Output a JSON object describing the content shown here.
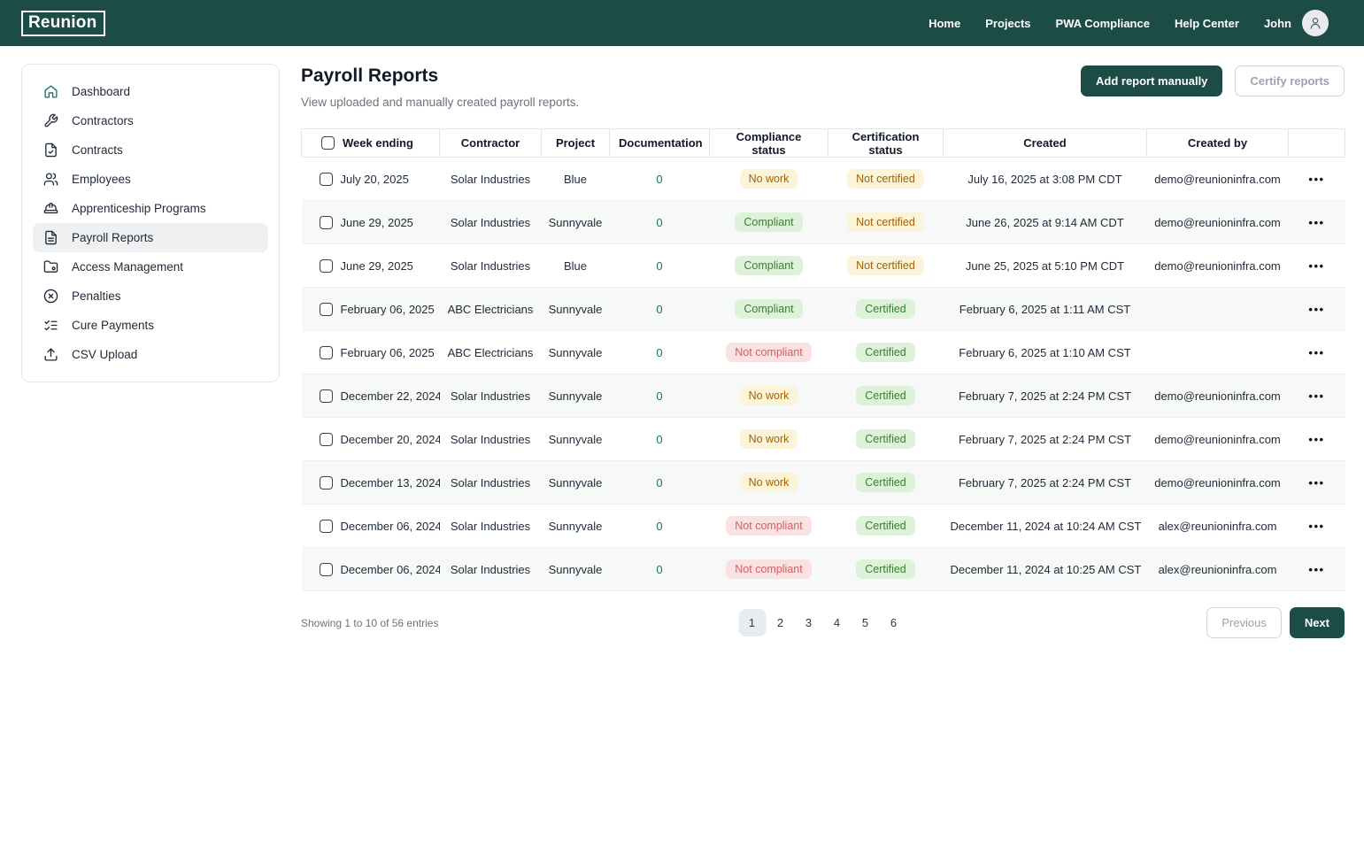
{
  "brand": {
    "logo": "Reunion"
  },
  "navbar": {
    "items": [
      {
        "label": "Home"
      },
      {
        "label": "Projects"
      },
      {
        "label": "PWA Compliance"
      },
      {
        "label": "Help Center"
      }
    ],
    "user": "John"
  },
  "sidebar": {
    "items": [
      {
        "label": "Dashboard",
        "icon": "home-icon",
        "active": false,
        "accent": true
      },
      {
        "label": "Contractors",
        "icon": "wrench-icon",
        "active": false
      },
      {
        "label": "Contracts",
        "icon": "file-check-icon",
        "active": false
      },
      {
        "label": "Employees",
        "icon": "users-icon",
        "active": false
      },
      {
        "label": "Apprenticeship Programs",
        "icon": "hard-hat-icon",
        "active": false
      },
      {
        "label": "Payroll Reports",
        "icon": "file-text-icon",
        "active": true
      },
      {
        "label": "Access Management",
        "icon": "folder-user-icon",
        "active": false
      },
      {
        "label": "Penalties",
        "icon": "x-circle-icon",
        "active": false
      },
      {
        "label": "Cure Payments",
        "icon": "list-checks-icon",
        "active": false
      },
      {
        "label": "CSV Upload",
        "icon": "upload-icon",
        "active": false
      }
    ]
  },
  "page": {
    "title": "Payroll Reports",
    "subtitle": "View uploaded and manually created payroll reports.",
    "add_button": "Add report manually",
    "certify_button": "Certify reports"
  },
  "table": {
    "columns": [
      "Week ending",
      "Contractor",
      "Project",
      "Documentation",
      "Compliance status",
      "Certification status",
      "Created",
      "Created by"
    ],
    "rows": [
      {
        "week": "July 20, 2025",
        "contractor": "Solar Industries",
        "project": "Blue",
        "documentation": "0",
        "compliance": {
          "label": "No work",
          "type": "warning"
        },
        "certification": {
          "label": "Not certified",
          "type": "warning"
        },
        "created": "July 16, 2025 at 3:08 PM CDT",
        "created_by": "demo@reunioninfra.com"
      },
      {
        "week": "June 29, 2025",
        "contractor": "Solar Industries",
        "project": "Sunnyvale",
        "documentation": "0",
        "compliance": {
          "label": "Compliant",
          "type": "success"
        },
        "certification": {
          "label": "Not certified",
          "type": "warning"
        },
        "created": "June 26, 2025 at 9:14 AM CDT",
        "created_by": "demo@reunioninfra.com"
      },
      {
        "week": "June 29, 2025",
        "contractor": "Solar Industries",
        "project": "Blue",
        "documentation": "0",
        "compliance": {
          "label": "Compliant",
          "type": "success"
        },
        "certification": {
          "label": "Not certified",
          "type": "warning"
        },
        "created": "June 25, 2025 at 5:10 PM CDT",
        "created_by": "demo@reunioninfra.com"
      },
      {
        "week": "February 06, 2025",
        "contractor": "ABC Electricians",
        "project": "Sunnyvale",
        "documentation": "0",
        "compliance": {
          "label": "Compliant",
          "type": "success"
        },
        "certification": {
          "label": "Certified",
          "type": "success"
        },
        "created": "February 6, 2025 at 1:11 AM CST",
        "created_by": ""
      },
      {
        "week": "February 06, 2025",
        "contractor": "ABC Electricians",
        "project": "Sunnyvale",
        "documentation": "0",
        "compliance": {
          "label": "Not compliant",
          "type": "danger"
        },
        "certification": {
          "label": "Certified",
          "type": "success"
        },
        "created": "February 6, 2025 at 1:10 AM CST",
        "created_by": ""
      },
      {
        "week": "December 22, 2024",
        "contractor": "Solar Industries",
        "project": "Sunnyvale",
        "documentation": "0",
        "compliance": {
          "label": "No work",
          "type": "warning"
        },
        "certification": {
          "label": "Certified",
          "type": "success"
        },
        "created": "February 7, 2025 at 2:24 PM CST",
        "created_by": "demo@reunioninfra.com"
      },
      {
        "week": "December 20, 2024",
        "contractor": "Solar Industries",
        "project": "Sunnyvale",
        "documentation": "0",
        "compliance": {
          "label": "No work",
          "type": "warning"
        },
        "certification": {
          "label": "Certified",
          "type": "success"
        },
        "created": "February 7, 2025 at 2:24 PM CST",
        "created_by": "demo@reunioninfra.com"
      },
      {
        "week": "December 13, 2024",
        "contractor": "Solar Industries",
        "project": "Sunnyvale",
        "documentation": "0",
        "compliance": {
          "label": "No work",
          "type": "warning"
        },
        "certification": {
          "label": "Certified",
          "type": "success"
        },
        "created": "February 7, 2025 at 2:24 PM CST",
        "created_by": "demo@reunioninfra.com"
      },
      {
        "week": "December 06, 2024",
        "contractor": "Solar Industries",
        "project": "Sunnyvale",
        "documentation": "0",
        "compliance": {
          "label": "Not compliant",
          "type": "danger"
        },
        "certification": {
          "label": "Certified",
          "type": "success"
        },
        "created": "December 11, 2024 at 10:24 AM CST",
        "created_by": "alex@reunioninfra.com"
      },
      {
        "week": "December 06, 2024",
        "contractor": "Solar Industries",
        "project": "Sunnyvale",
        "documentation": "0",
        "compliance": {
          "label": "Not compliant",
          "type": "danger"
        },
        "certification": {
          "label": "Certified",
          "type": "success"
        },
        "created": "December 11, 2024 at 10:25 AM CST",
        "created_by": "alex@reunioninfra.com"
      }
    ]
  },
  "pagination": {
    "summary": "Showing 1 to 10 of 56 entries",
    "pages": [
      "1",
      "2",
      "3",
      "4",
      "5",
      "6"
    ],
    "current": "1",
    "previous_label": "Previous",
    "next_label": "Next"
  },
  "colors": {
    "brand_dark_teal": "#1d4b46",
    "badge_warning_bg": "#fbf4d9",
    "badge_warning_text": "#a16207",
    "badge_success_bg": "#ddf2d8",
    "badge_success_text": "#3d7c36",
    "badge_danger_bg": "#fbe2e2",
    "badge_danger_text": "#d65d5d"
  }
}
